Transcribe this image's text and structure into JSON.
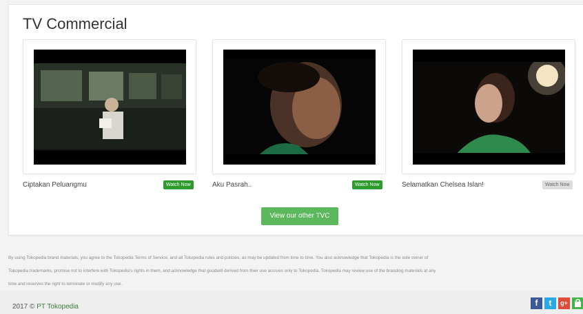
{
  "section": {
    "title": "TV Commercial"
  },
  "videos": [
    {
      "caption": "Ciptakan Peluangmu",
      "button": "Watch Now",
      "state": "active"
    },
    {
      "caption": "Aku Pasrah..",
      "button": "Watch Now",
      "state": "active"
    },
    {
      "caption": "Selamatkan Chelsea Islan!",
      "button": "Watch Now",
      "state": "disabled"
    }
  ],
  "cta": {
    "label": "View our other TVC"
  },
  "disclaimer": "By using Tokopedia brand materials, you agree to the Tokopedia Terms of Service, and all Tokopedia rules and policies, as may be updated from time to time. You also acknowledge that Tokopedia is the sole owner of\nTokopedia trademarks, promise not to interfere with Tokopedia's rights in them, and acknowledge that goodwill derived from their use accrues only to Tokopedia. Tokopedia may review use of the branding materials at any\ntime and reserves the right to terminate or modify any use.",
  "footer": {
    "year": "2017 ©",
    "holder": "PT Tokopedia"
  },
  "social": [
    {
      "icon": "facebook-icon",
      "glyph": "f",
      "color": "#3b5998"
    },
    {
      "icon": "twitter-icon",
      "glyph": "t",
      "color": "#29a9e1"
    },
    {
      "icon": "google-plus-icon",
      "glyph": "g+",
      "color": "#dd4b39"
    },
    {
      "icon": "share-icon",
      "glyph": "",
      "color": "#42b549"
    }
  ],
  "colors": {
    "green_button": "#2e9b2e",
    "cta": "#5cb85c",
    "disabled_button": "#dddddd"
  }
}
